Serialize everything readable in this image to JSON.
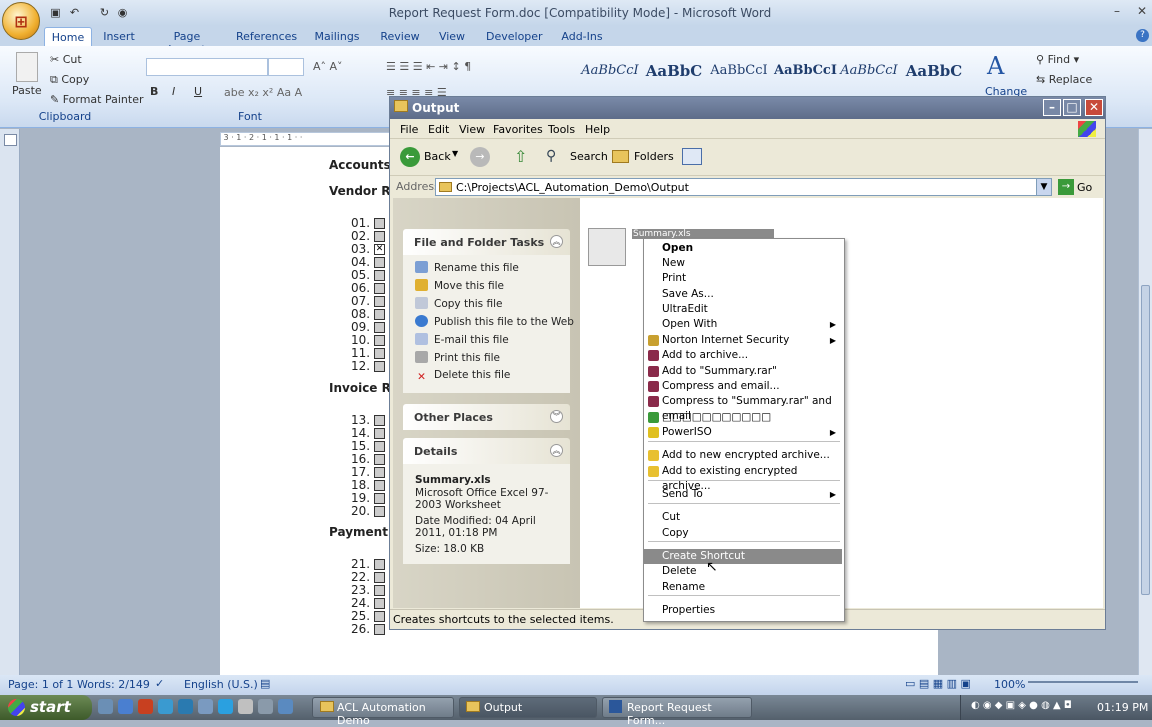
{
  "word": {
    "title": "Report Request Form.doc [Compatibility Mode] - Microsoft Word",
    "tabs": [
      "Home",
      "Insert",
      "Page Layout",
      "References",
      "Mailings",
      "Review",
      "View",
      "Developer",
      "Add-Ins"
    ],
    "clipboard": {
      "paste": "Paste",
      "cut": "Cut",
      "copy": "Copy",
      "format_painter": "Format Painter",
      "group": "Clipboard"
    },
    "font_group": "Font",
    "styles": [
      "AaBbCcI",
      "AaBbC",
      "AaBbCcI",
      "AaBbCcI",
      "AaBbCcI",
      "AaBbC"
    ],
    "change_styles": "Change",
    "editing": {
      "find": "Find",
      "replace": "Replace"
    },
    "doc": {
      "headings": [
        "Accounts",
        "Vendor Re",
        "Invoice Re",
        "Payment"
      ],
      "numbers_a": [
        "01.",
        "02.",
        "03.",
        "04.",
        "05.",
        "06.",
        "07.",
        "08.",
        "09.",
        "10.",
        "11.",
        "12."
      ],
      "numbers_b": [
        "13.",
        "14.",
        "15.",
        "16.",
        "17.",
        "18.",
        "19.",
        "20."
      ],
      "numbers_c": [
        "21.",
        "22.",
        "23.",
        "24.",
        "25.",
        "26."
      ]
    },
    "status": {
      "page": "Page: 1 of 1",
      "words": "Words: 2/149",
      "language": "English (U.S.)",
      "zoom": "100%"
    }
  },
  "explorer": {
    "title": "Output",
    "menu": [
      "File",
      "Edit",
      "View",
      "Favorites",
      "Tools",
      "Help"
    ],
    "toolbar": {
      "back": "Back",
      "search": "Search",
      "folders": "Folders"
    },
    "address_label": "Address",
    "address": "C:\\Projects\\ACL_Automation_Demo\\Output",
    "go": "Go",
    "tasks_title": "File and Folder Tasks",
    "tasks": [
      "Rename this file",
      "Move this file",
      "Copy this file",
      "Publish this file to the Web",
      "E-mail this file",
      "Print this file",
      "Delete this file"
    ],
    "other_places": "Other Places",
    "details_title": "Details",
    "details": {
      "name": "Summary.xls",
      "type": "Microsoft Office Excel 97-2003 Worksheet",
      "modified": "Date Modified: 04 April 2011, 01:18 PM",
      "size": "Size: 18.0 KB"
    },
    "file_label": "Summary.xls",
    "status": "Creates shortcuts to the selected items."
  },
  "context_menu": [
    "Open",
    "New",
    "Print",
    "Save As...",
    "UltraEdit",
    "Open With",
    "Norton Internet Security",
    "Add to archive...",
    "Add to \"Summary.rar\"",
    "Compress and email...",
    "Compress to \"Summary.rar\" and email",
    "□□□□□□□□□□□",
    "PowerISO",
    "Add to new encrypted archive...",
    "Add to existing encrypted archive...",
    "Send To",
    "Cut",
    "Copy",
    "Create Shortcut",
    "Delete",
    "Rename",
    "Properties"
  ],
  "taskbar": {
    "start": "start",
    "buttons": [
      "ACL Automation Demo",
      "Output",
      "Report Request Form..."
    ],
    "time": "01:19 PM"
  }
}
